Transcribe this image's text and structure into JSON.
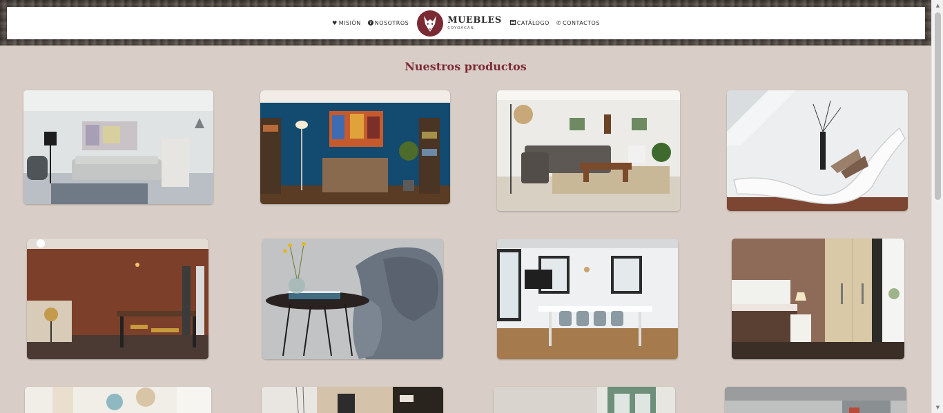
{
  "nav": {
    "left": [
      {
        "label": "Misión",
        "icon": "heart-icon"
      },
      {
        "label": "Nosotros",
        "icon": "question-icon"
      }
    ],
    "right": [
      {
        "label": "Catálogo",
        "icon": "catalog-icon"
      },
      {
        "label": "Contactos",
        "icon": "phone-icon"
      }
    ]
  },
  "logo": {
    "title": "MUEBLES",
    "subtitle": "COYOACÁN",
    "color": "#7a2a33"
  },
  "main": {
    "title": "Nuestros productos"
  },
  "products": [
    {
      "name": "product-living-room-gray-sofa"
    },
    {
      "name": "product-blue-wall-dresser"
    },
    {
      "name": "product-sectional-sofa"
    },
    {
      "name": "product-white-chaise-lounge"
    },
    {
      "name": "product-brick-dining-room"
    },
    {
      "name": "product-side-table-armchair"
    },
    {
      "name": "product-white-dining-table"
    },
    {
      "name": "product-bedroom-wardrobe"
    },
    {
      "name": "product-row3-1"
    },
    {
      "name": "product-row3-2"
    },
    {
      "name": "product-row3-3"
    },
    {
      "name": "product-row3-4"
    }
  ],
  "colors": {
    "accent": "#7b2c35",
    "background": "#d9cec7"
  }
}
